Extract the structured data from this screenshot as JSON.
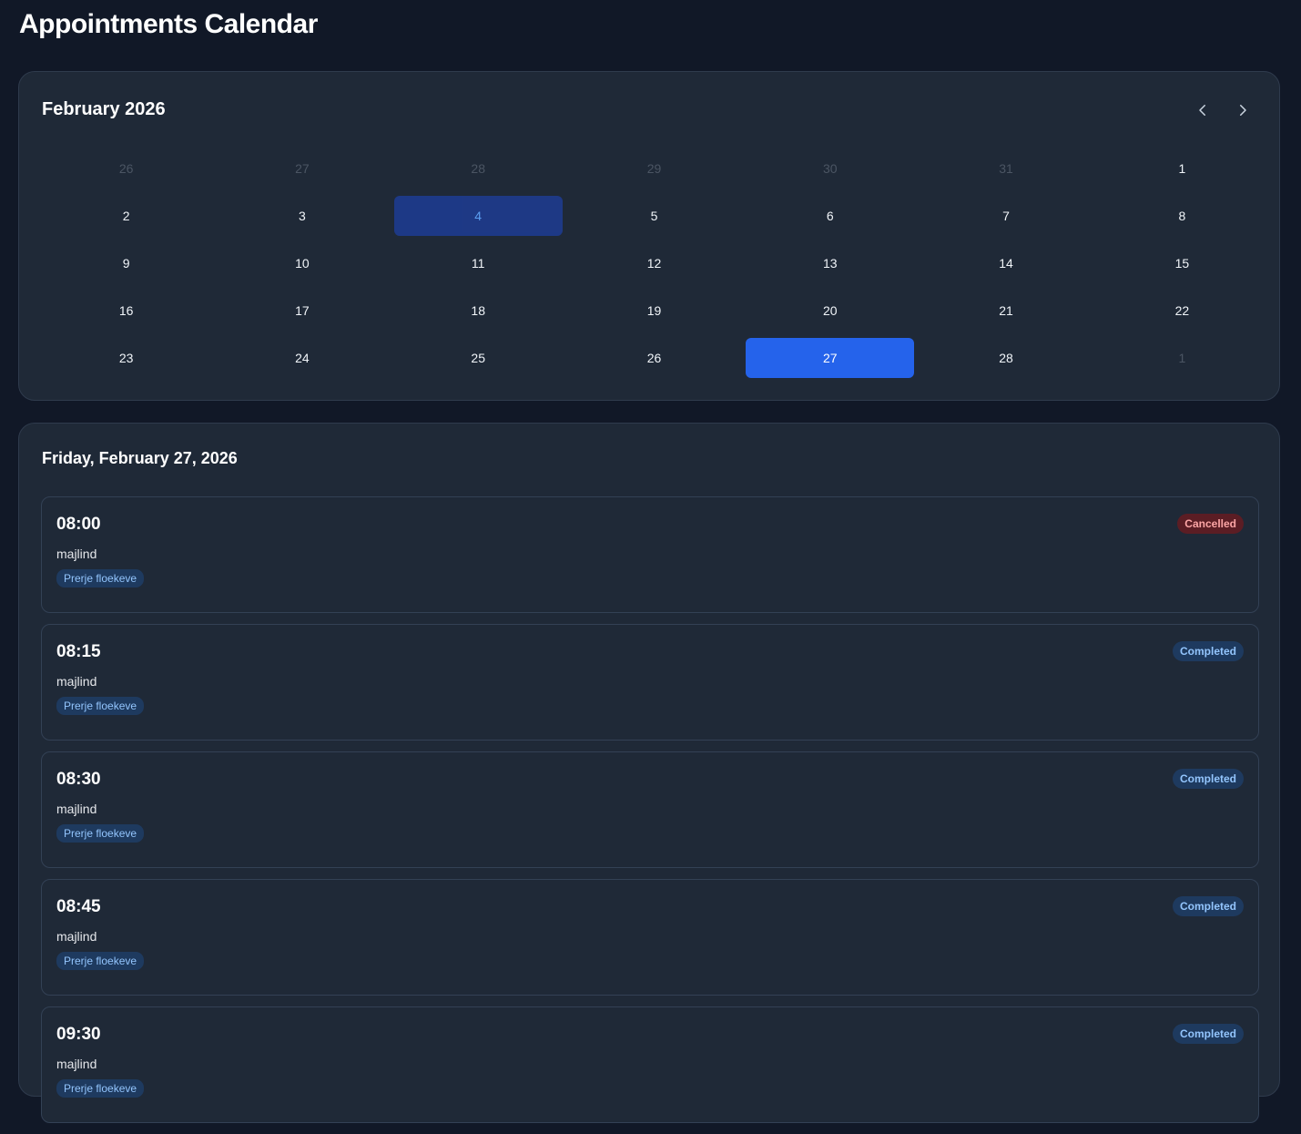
{
  "page": {
    "title": "Appointments Calendar"
  },
  "calendar": {
    "month_label": "February 2026",
    "prev_icon": "chevron-left-icon",
    "next_icon": "chevron-right-icon",
    "days": [
      {
        "label": "26",
        "state": "muted"
      },
      {
        "label": "27",
        "state": "muted"
      },
      {
        "label": "28",
        "state": "muted"
      },
      {
        "label": "29",
        "state": "muted"
      },
      {
        "label": "30",
        "state": "muted"
      },
      {
        "label": "31",
        "state": "muted"
      },
      {
        "label": "1",
        "state": "normal"
      },
      {
        "label": "2",
        "state": "normal"
      },
      {
        "label": "3",
        "state": "normal"
      },
      {
        "label": "4",
        "state": "today"
      },
      {
        "label": "5",
        "state": "normal"
      },
      {
        "label": "6",
        "state": "normal"
      },
      {
        "label": "7",
        "state": "normal"
      },
      {
        "label": "8",
        "state": "normal"
      },
      {
        "label": "9",
        "state": "normal"
      },
      {
        "label": "10",
        "state": "normal"
      },
      {
        "label": "11",
        "state": "normal"
      },
      {
        "label": "12",
        "state": "normal"
      },
      {
        "label": "13",
        "state": "normal"
      },
      {
        "label": "14",
        "state": "normal"
      },
      {
        "label": "15",
        "state": "normal"
      },
      {
        "label": "16",
        "state": "normal"
      },
      {
        "label": "17",
        "state": "normal"
      },
      {
        "label": "18",
        "state": "normal"
      },
      {
        "label": "19",
        "state": "normal"
      },
      {
        "label": "20",
        "state": "normal"
      },
      {
        "label": "21",
        "state": "normal"
      },
      {
        "label": "22",
        "state": "normal"
      },
      {
        "label": "23",
        "state": "normal"
      },
      {
        "label": "24",
        "state": "normal"
      },
      {
        "label": "25",
        "state": "normal"
      },
      {
        "label": "26",
        "state": "normal"
      },
      {
        "label": "27",
        "state": "selected"
      },
      {
        "label": "28",
        "state": "normal"
      },
      {
        "label": "1",
        "state": "muted"
      }
    ]
  },
  "day_view": {
    "date_label": "Friday, February 27, 2026",
    "appointments": [
      {
        "time": "08:00",
        "client": "majlind",
        "service": "Prerje floekeve",
        "status": "Cancelled",
        "status_type": "cancelled"
      },
      {
        "time": "08:15",
        "client": "majlind",
        "service": "Prerje floekeve",
        "status": "Completed",
        "status_type": "completed"
      },
      {
        "time": "08:30",
        "client": "majlind",
        "service": "Prerje floekeve",
        "status": "Completed",
        "status_type": "completed"
      },
      {
        "time": "08:45",
        "client": "majlind",
        "service": "Prerje floekeve",
        "status": "Completed",
        "status_type": "completed"
      },
      {
        "time": "09:30",
        "client": "majlind",
        "service": "Prerje floekeve",
        "status": "Completed",
        "status_type": "completed"
      }
    ]
  },
  "colors": {
    "background": "#111827",
    "card": "#1f2937",
    "accent": "#2563eb",
    "today_bg": "#1e3a8a",
    "completed": "#93c5fd",
    "cancelled": "#fca5a5"
  }
}
